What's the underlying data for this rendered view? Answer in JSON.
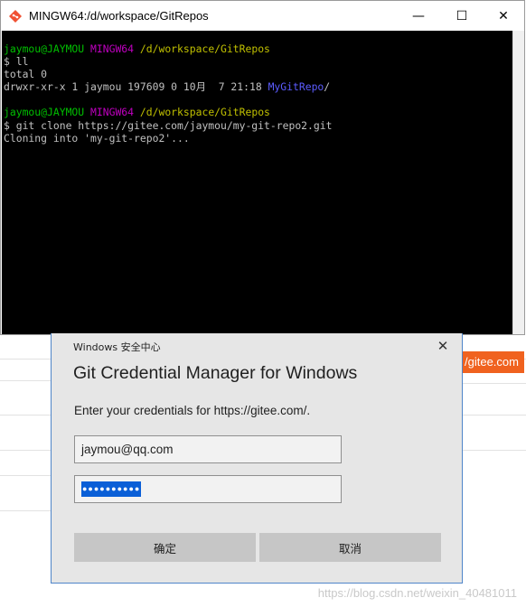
{
  "terminal": {
    "title": "MINGW64:/d/workspace/GitRepos",
    "controls": {
      "minimize": "—",
      "maximize": "☐",
      "close": "✕"
    },
    "prompt1": {
      "user": "jaymou@JAYMOU",
      "shell": "MINGW64",
      "path": "/d/workspace/GitRepos"
    },
    "cmd1": "$ ll",
    "out_total": "total 0",
    "out_listing": "drwxr-xr-x 1 jaymou 197609 0 10月  7 21:18 ",
    "out_dir": "MyGitRepo",
    "out_dir_suffix": "/",
    "prompt2": {
      "user": "jaymou@JAYMOU",
      "shell": "MINGW64",
      "path": "/d/workspace/GitRepos"
    },
    "cmd2": "$ git clone https://gitee.com/jaymou/my-git-repo2.git",
    "out_cloning": "Cloning into 'my-git-repo2'..."
  },
  "dialog": {
    "caption": "Windows 安全中心",
    "close": "✕",
    "heading": "Git Credential Manager for Windows",
    "prompt": "Enter your credentials for https://gitee.com/.",
    "username": "jaymou@qq.com",
    "password_mask": "●●●●●●●●●●",
    "ok_label": "确定",
    "cancel_label": "取消"
  },
  "background": {
    "url_fragment": "/gitee.com",
    "watermark": "https://blog.csdn.net/weixin_40481011"
  }
}
